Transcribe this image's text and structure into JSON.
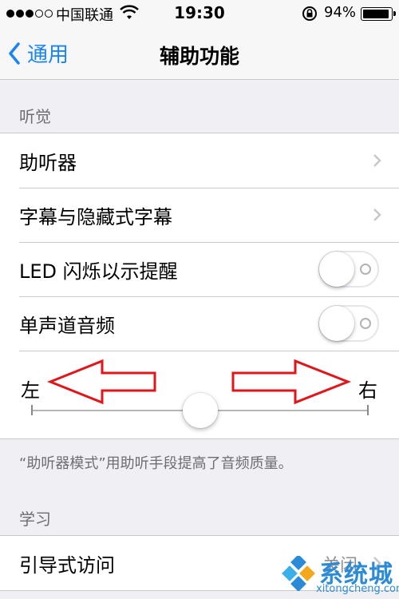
{
  "status_bar": {
    "carrier": "中国联通",
    "time": "19:30",
    "battery": "94%",
    "battery_level": 0.94,
    "signal_bars_filled": 3,
    "signal_bars_total": 5,
    "icons": [
      "signal-icon",
      "wifi-icon",
      "rotation-lock-icon",
      "battery-icon"
    ]
  },
  "nav": {
    "back_label": "通用",
    "title": "辅助功能"
  },
  "hearing": {
    "header": "听觉",
    "items": [
      {
        "label": "助听器",
        "type": "disclosure"
      },
      {
        "label": "字幕与隐藏式字幕",
        "type": "disclosure"
      },
      {
        "label": "LED 闪烁以示提醒",
        "type": "toggle",
        "on": false
      },
      {
        "label": "单声道音频",
        "type": "toggle",
        "on": false
      }
    ],
    "balance": {
      "left_label": "左",
      "right_label": "右",
      "value": 0.5
    },
    "footnote": "“助听器模式”用助听手段提高了音频质量。"
  },
  "learning": {
    "header": "学习",
    "items": [
      {
        "label": "引导式访问",
        "value": "关闭",
        "type": "disclosure"
      }
    ]
  },
  "watermark": {
    "text": "系统城",
    "url": "xitongcheng.com"
  },
  "colors": {
    "accent": "#1a84f2",
    "background": "#efeff4",
    "annotation_arrow": "#e0161b",
    "watermark": "#2b8bd6"
  }
}
